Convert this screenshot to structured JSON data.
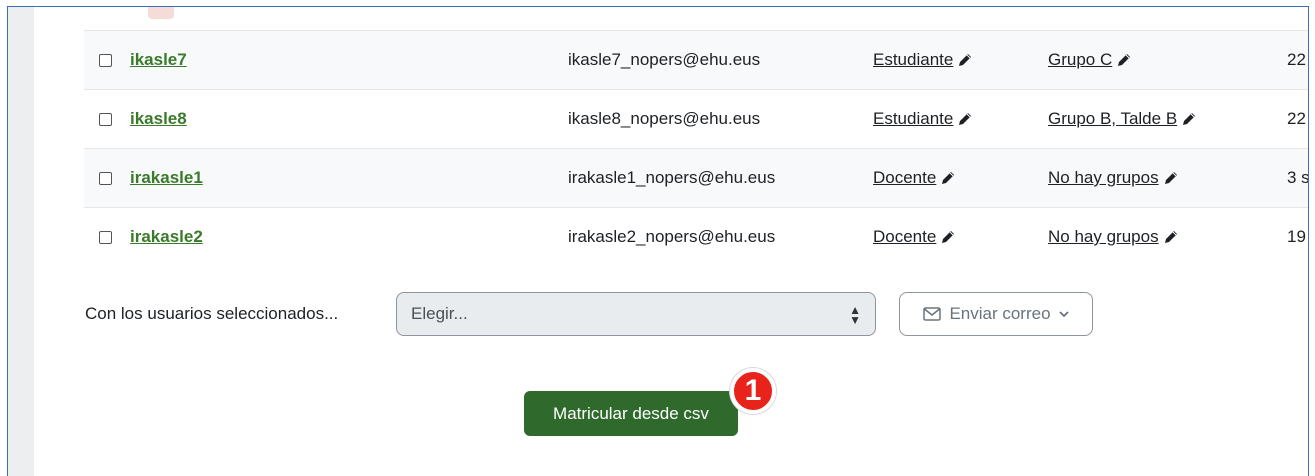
{
  "participants": [
    {
      "username": "ikasle7",
      "email": "ikasle7_nopers@ehu.eus",
      "role": "Estudiante",
      "groups": "Grupo C",
      "last_access": "22"
    },
    {
      "username": "ikasle8",
      "email": "ikasle8_nopers@ehu.eus",
      "role": "Estudiante",
      "groups": "Grupo B, Talde B",
      "last_access": "22"
    },
    {
      "username": "irakasle1",
      "email": "irakasle1_nopers@ehu.eus",
      "role": "Docente",
      "groups": "No hay grupos",
      "last_access": "3 s"
    },
    {
      "username": "irakasle2",
      "email": "irakasle2_nopers@ehu.eus",
      "role": "Docente",
      "groups": "No hay grupos",
      "last_access": "19"
    }
  ],
  "bulk": {
    "label": "Con los usuarios seleccionados...",
    "select_value": "Elegir...",
    "send_mail_label": "Enviar correo"
  },
  "enrol_csv_button": "Matricular desde csv",
  "callout_number": "1",
  "colors": {
    "link_green": "#3a7a2a",
    "button_green": "#2f6a2c",
    "badge_red": "#e8231b",
    "frame_blue": "#3a6fb5"
  },
  "icons": [
    "checkbox-icon",
    "pencil-icon",
    "envelope-icon",
    "chevron-down-icon",
    "sort-arrows-icon"
  ]
}
